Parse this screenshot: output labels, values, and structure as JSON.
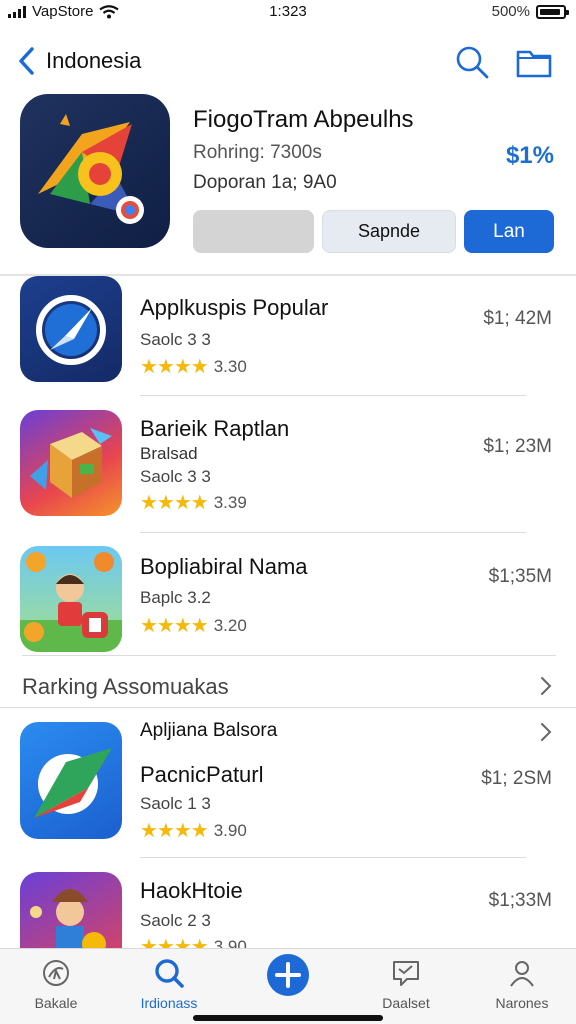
{
  "status_bar": {
    "carrier": "VapStore",
    "time": "1:323",
    "battery": "500%"
  },
  "nav": {
    "back_label": "Indonesia",
    "back_icon": "chevron-left-icon",
    "search_icon": "search-icon",
    "folder_icon": "folder-icon"
  },
  "featured": {
    "title": "FiogoTram Abpeulhs",
    "line1": "Rohring: 7300s",
    "line2": "Doporan 1a; 9A0",
    "price": "$1%",
    "button_middle": "Sapnde",
    "button_primary": "Lan"
  },
  "apps": [
    {
      "name": "Applkuspis Popular",
      "meta": "Saolc 3 3",
      "rating": "3.30",
      "stars": 4,
      "price": "$1; 42M",
      "icon": "compass-icon"
    },
    {
      "name": "Barieik Raptlan",
      "subtitle": "Bralsad",
      "meta": "Saolc 3 3",
      "rating": "3.39",
      "stars": 4,
      "price": "$1; 23M",
      "icon": "cube-game-icon"
    },
    {
      "name": "Bopliabiral Nama",
      "meta": "Baplc 3.2",
      "rating": "3.20",
      "stars": 4,
      "price": "$1;35M",
      "icon": "kid-game-icon"
    }
  ],
  "section": {
    "title": "Rarking Assomuakas",
    "chevron_icon": "chevron-right-icon"
  },
  "ranking": {
    "subheading": "Apljiana Balsora",
    "apps": [
      {
        "name": "PacnicPaturl",
        "meta": "Saolc 1 3",
        "rating": "3.90",
        "stars": 4,
        "price": "$1; 2SM",
        "icon": "leaf-arrow-icon"
      },
      {
        "name": "HaokHtoie",
        "meta": "Saolc 2 3",
        "rating": "3.90",
        "stars": 4,
        "price": "$1;33M",
        "icon": "hero-character-icon"
      }
    ]
  },
  "tabs": [
    {
      "label": "Bakale",
      "icon": "globe-icon",
      "active": false
    },
    {
      "label": "Irdionass",
      "icon": "search-icon",
      "active": true
    },
    {
      "label": "",
      "icon": "plus-circle-icon",
      "active": false
    },
    {
      "label": "Daalset",
      "icon": "message-icon",
      "active": false
    },
    {
      "label": "Narones",
      "icon": "person-icon",
      "active": false
    }
  ],
  "colors": {
    "accent": "#1d6ad6",
    "star": "#f5b90a",
    "price": "#1c6fd1"
  }
}
